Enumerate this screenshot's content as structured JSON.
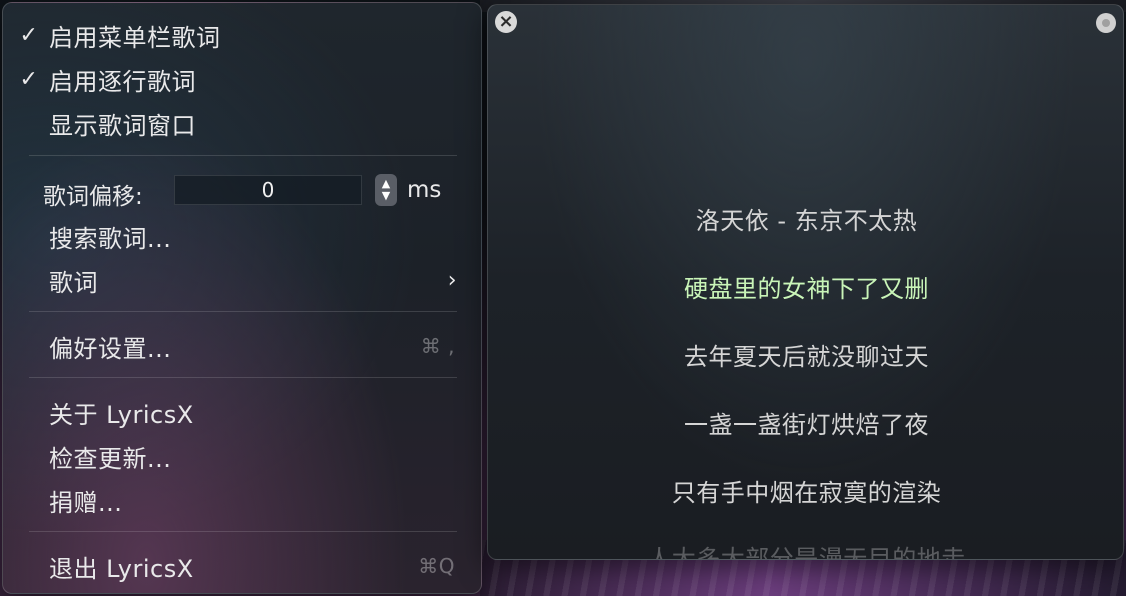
{
  "menu": {
    "items": [
      {
        "check": "✓",
        "label": "启用菜单栏歌词"
      },
      {
        "check": "✓",
        "label": "启用逐行歌词"
      },
      {
        "check": "",
        "label": "显示歌词窗口"
      }
    ],
    "offset": {
      "label": "歌词偏移:",
      "value": "0",
      "unit": "ms"
    },
    "search_label": "搜索歌词...",
    "lyrics_submenu_label": "歌词",
    "preferences": {
      "label": "偏好设置...",
      "shortcut": "⌘ ,"
    },
    "about_label": "关于 LyricsX",
    "check_updates_label": "检查更新...",
    "donate_label": "捐赠...",
    "quit": {
      "label": "退出 LyricsX",
      "shortcut": "⌘Q"
    }
  },
  "lyrics_window": {
    "lines": [
      "洛天依 - 东京不太热",
      "硬盘里的女神下了又删",
      "去年夏天后就没聊过天",
      "一盏一盏街灯烘焙了夜",
      "只有手中烟在寂寞的渲染",
      "人大多大部分是漫无目的地走"
    ],
    "current_line_color": "#c9f5b8"
  }
}
